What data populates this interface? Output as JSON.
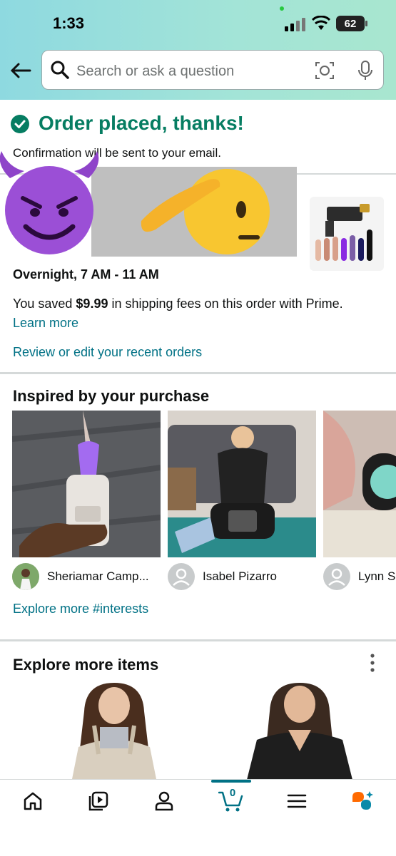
{
  "status_bar": {
    "time": "1:33",
    "battery": "62"
  },
  "search": {
    "placeholder": "Search or ask a question"
  },
  "confirmation": {
    "title": "Order placed, thanks!",
    "subtitle": "Confirmation will be sent to your email."
  },
  "delivery": {
    "window": "Overnight, 7 AM - 11 AM",
    "saved_prefix": "You saved ",
    "saved_amount": "$9.99",
    "saved_suffix": " in shipping fees on this order with Prime.",
    "learn_more": "Learn more",
    "review_link": "Review or edit your recent orders"
  },
  "inspired": {
    "title": "Inspired by your purchase",
    "posts": [
      {
        "author": "Sheriamar Camp..."
      },
      {
        "author": "Isabel Pizarro"
      },
      {
        "author": "Lynn Sr"
      }
    ],
    "explore_link": "Explore more #interests"
  },
  "explore_items": {
    "title": "Explore more items"
  },
  "tab_bar": {
    "items": [
      "home-icon",
      "video-icon",
      "account-icon",
      "cart-icon",
      "menu-icon",
      "rufus-icon"
    ],
    "cart_count": "0",
    "accent_color": "#007185"
  },
  "colors": {
    "success": "#067d62",
    "link": "#007185"
  }
}
